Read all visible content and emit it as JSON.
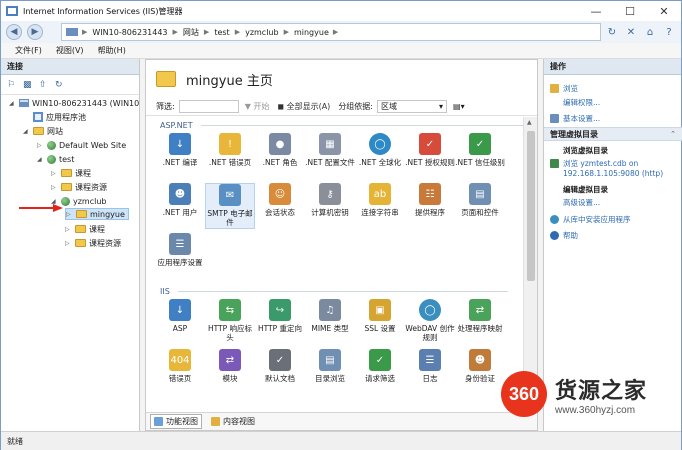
{
  "window": {
    "title": "Internet Information Services (IIS)管理器"
  },
  "address": {
    "crumbs": [
      "WIN10-806231443",
      "网站",
      "test",
      "yzmclub",
      "mingyue"
    ]
  },
  "menu": [
    "文件(F)",
    "视图(V)",
    "帮助(H)"
  ],
  "left_pane": {
    "header": "连接",
    "tree": [
      {
        "label": "WIN10-806231443 (WIN10",
        "icon": "server-icon"
      },
      {
        "label": "应用程序池",
        "icon": "app-pool-icon"
      },
      {
        "label": "网站",
        "icon": "sites-icon"
      },
      {
        "label": "Default Web Site",
        "icon": "globe-icon"
      },
      {
        "label": "test",
        "icon": "globe-icon"
      },
      {
        "label": "课程",
        "icon": "folder-icon"
      },
      {
        "label": "课程资源",
        "icon": "folder-icon"
      },
      {
        "label": "yzmclub",
        "icon": "app-icon"
      },
      {
        "label": "mingyue",
        "icon": "folder-icon"
      },
      {
        "label": "课程",
        "icon": "folder-icon"
      },
      {
        "label": "课程资源",
        "icon": "folder-icon"
      }
    ]
  },
  "center": {
    "title": "mingyue 主页",
    "filter_label": "筛选:",
    "start_label": "开始",
    "show_all_label": "全部显示(A)",
    "group_label": "分组依据:",
    "group_value": "区域",
    "sections": [
      {
        "name": "ASP.NET",
        "items": [
          ".NET 编译",
          ".NET 错误页",
          ".NET 角色",
          ".NET 配置文件",
          ".NET 全球化",
          ".NET 授权规则",
          ".NET 信任级别",
          ".NET 用户",
          "SMTP 电子邮件",
          "会话状态",
          "计算机密钥",
          "连接字符串",
          "提供程序",
          "页面和控件",
          "应用程序设置"
        ]
      },
      {
        "name": "IIS",
        "items": [
          "ASP",
          "HTTP 响应标头",
          "HTTP 重定向",
          "MIME 类型",
          "SSL 设置",
          "WebDAV 创作规则",
          "处理程序映射",
          "错误页",
          "模块",
          "默认文档",
          "目录浏览",
          "请求筛选",
          "日志",
          "身份验证"
        ]
      }
    ],
    "tabs": [
      "功能视图",
      "内容视图"
    ]
  },
  "right_pane": {
    "header": "操作",
    "browse": "浏览",
    "edit_perms": "编辑权限...",
    "basic_settings": "基本设置...",
    "manage_vdir": "管理虚拟目录",
    "browse_vdir": "浏览虚拟目录",
    "browse_link": "浏览 yzmtest.cdb on",
    "browse_link2": "192.168.1.105:9080 (http)",
    "edit_vdir": "编辑虚拟目录",
    "advanced": "高级设置...",
    "gallery": "从库中安装应用程序",
    "help": "帮助"
  },
  "status": "就绪",
  "watermark": {
    "badge": "360",
    "text": "货源之家",
    "url": "www.360hyzj.com"
  }
}
